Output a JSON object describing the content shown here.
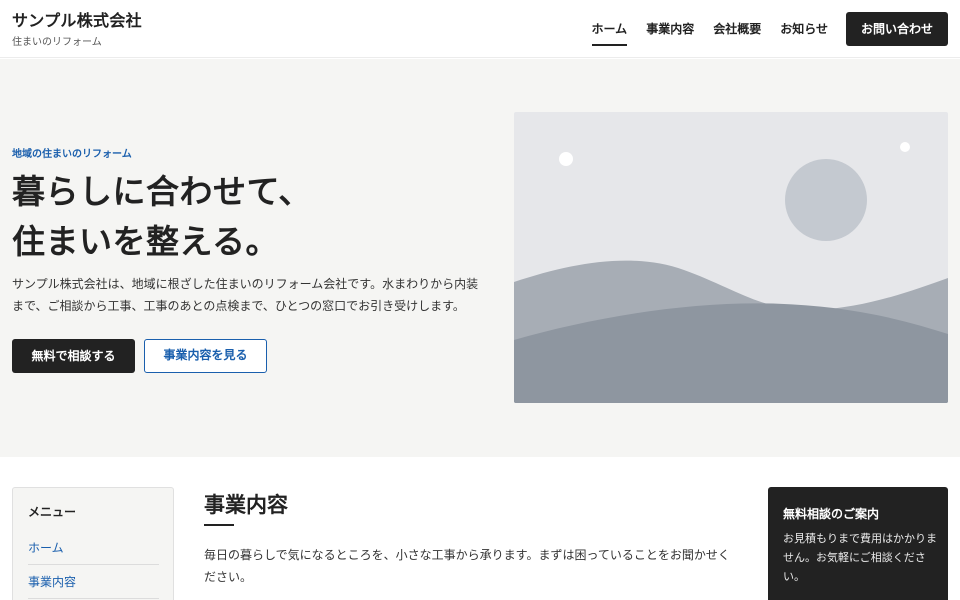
{
  "header": {
    "company_name": "サンプル株式会社",
    "tagline": "住まいのリフォーム",
    "nav": [
      {
        "label": "ホーム",
        "active": true
      },
      {
        "label": "事業内容",
        "active": false
      },
      {
        "label": "会社概要",
        "active": false
      },
      {
        "label": "お知らせ",
        "active": false
      }
    ],
    "contact_button": "お問い合わせ"
  },
  "hero": {
    "eyebrow": "地域の住まいのリフォーム",
    "title_line1": "暮らしに合わせて、",
    "title_line2": "住まいを整える。",
    "description": "サンプル株式会社は、地域に根ざした住まいのリフォーム会社です。水まわりから内装まで、ご相談から工事、工事のあとの点検まで、ひとつの窓口でお引き受けします。",
    "primary_button": "無料で相談する",
    "secondary_button": "事業内容を見る",
    "image_icon": "landscape-placeholder-icon"
  },
  "sidebar": {
    "title": "メニュー",
    "links": [
      "ホーム",
      "事業内容"
    ]
  },
  "section": {
    "title": "事業内容",
    "text": "毎日の暮らしで気になるところを、小さな工事から承ります。まずは困っていることをお聞かせください。"
  },
  "cta": {
    "title": "無料相談のご案内",
    "text": "お見積もりまで費用はかかりません。お気軽にご相談ください。"
  },
  "colors": {
    "accent": "#1a5fad",
    "dark": "#222222",
    "hero_bg": "#f5f5f3"
  }
}
